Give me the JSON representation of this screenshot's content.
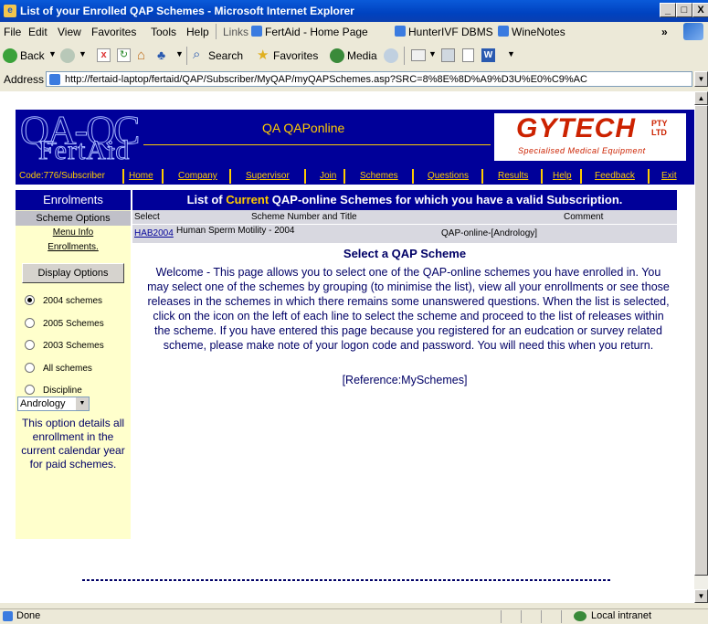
{
  "window": {
    "title": "List of your Enrolled QAP Schemes - Microsoft Internet Explorer",
    "min": "_",
    "max": "□",
    "close": "X"
  },
  "menu": {
    "items": [
      "File",
      "Edit",
      "View",
      "Favorites",
      "Tools",
      "Help"
    ],
    "links_label": "Links",
    "links": [
      "FertAid - Home Page",
      "HunterIVF DBMS",
      "WineNotes"
    ],
    "overflow": "»"
  },
  "toolbar": {
    "back": "Back",
    "search": "Search",
    "favorites": "Favorites",
    "media": "Media"
  },
  "address": {
    "label": "Address",
    "url": "http://fertaid-laptop/fertaid/QAP/Subscriber/MyQAP/myQAPSchemes.asp?SRC=8%8E%8D%A9%D3U%E0%C9%AC"
  },
  "banner": {
    "logo_top": "QA-QC",
    "logo_bottom": "FertAid",
    "title": "QA QAPonline",
    "brand": "GYTECH",
    "brand_suffix": "PTY LTD",
    "brand_tagline": "Specialised Medical Equipment"
  },
  "nav": {
    "code": "Code:776/Subscriber",
    "links": [
      "Home",
      "Company",
      "Supervisor",
      "Join",
      "Schemes",
      "Questions",
      "Results",
      "Help",
      "Feedback",
      "Exit"
    ]
  },
  "sidebar": {
    "heading": "Enrolments",
    "scheme_options": "Scheme Options",
    "menu_info": "Menu Info",
    "enrollments": "Enrollments.",
    "display_options": "Display Options",
    "radios": [
      {
        "label": "2004 schemes",
        "checked": true
      },
      {
        "label": "2005 Schemes",
        "checked": false
      },
      {
        "label": "2003 Schemes",
        "checked": false
      },
      {
        "label": "All schemes",
        "checked": false
      },
      {
        "label": "Discipline",
        "checked": false
      }
    ],
    "discipline_value": "Andrology",
    "description": "This option details all enrollment in the current calendar year for paid schemes."
  },
  "main": {
    "heading_pre": "List of",
    "heading_accent": "Current",
    "heading_post": "QAP-online Schemes for which you have a valid Subscription.",
    "columns": [
      "Select",
      "Scheme Number and Title",
      "Comment"
    ],
    "rows": [
      {
        "code": "HAB2004",
        "title": "Human Sperm Motility - 2004",
        "comment": "QAP-online-[Andrology]"
      }
    ],
    "select_title": "Select a QAP Scheme",
    "welcome": "Welcome - This page allows you to select one of the QAP-online schemes you have enrolled in. You may select one of the schemes by grouping (to minimise the list), view all your enrollments or see those releases in the schemes in which there remains some unanswered questions. When the list is selected, click on the icon on the left of each line to select the scheme and proceed to the list of releases within the scheme. If you have entered this page because you registered for an eudcation or survey related scheme, please make note of your logon code and password. You will need this when you return.",
    "reference": "[Reference:MySchemes]"
  },
  "status": {
    "text": "Done",
    "zone": "Local intranet"
  }
}
